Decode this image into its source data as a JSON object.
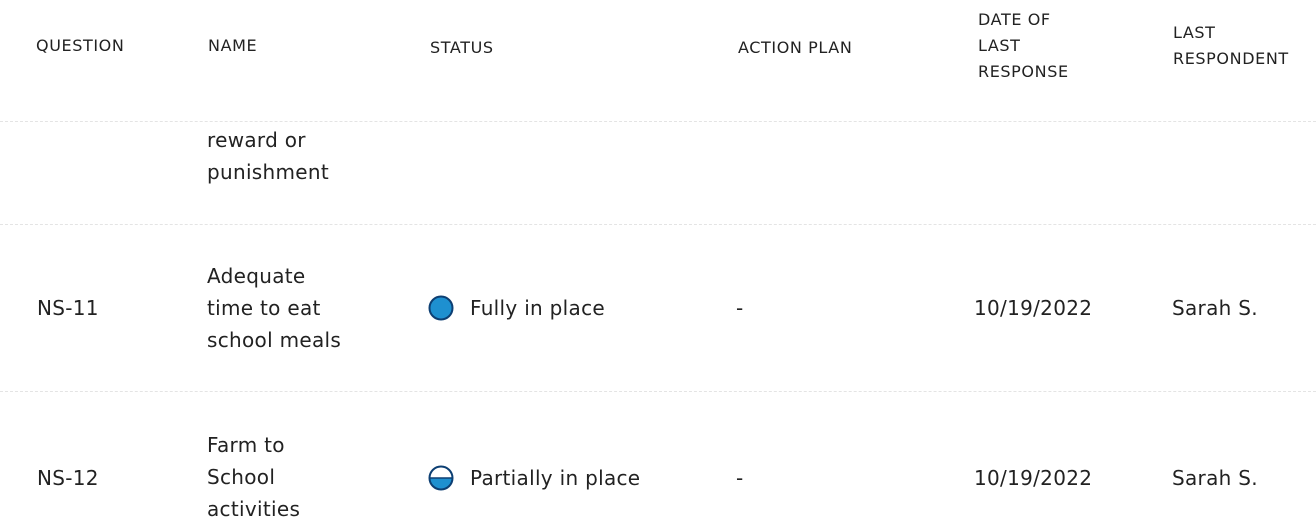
{
  "columns": {
    "question": "QUESTION",
    "name": "NAME",
    "status": "STATUS",
    "action_plan": "ACTION PLAN",
    "date_line1": "DATE OF",
    "date_line2": "LAST",
    "date_line3": "RESPONSE",
    "resp_line1": "LAST",
    "resp_line2": "RESPONDENT"
  },
  "rows": [
    {
      "question": "",
      "name_lines": [
        "reward or",
        "punishment"
      ],
      "status": "",
      "action_plan": "",
      "date": "",
      "respondent": ""
    },
    {
      "question": "NS-11",
      "name_lines": [
        "Adequate",
        "time to eat",
        "school meals"
      ],
      "status": "Fully in place",
      "status_level": 1.0,
      "action_plan": "-",
      "date": "10/19/2022",
      "respondent": "Sarah S."
    },
    {
      "question": "NS-12",
      "name_lines": [
        "Farm to",
        "School",
        "activities"
      ],
      "status": "Partially in place",
      "status_level": 0.5,
      "action_plan": "-",
      "date": "10/19/2022",
      "respondent": "Sarah S."
    }
  ],
  "colors": {
    "status_fill": "#1e90d0",
    "status_border": "#0d3f73",
    "divider": "#e4e4e4"
  },
  "icons": {
    "status_full": "full-circle-icon",
    "status_partial": "half-circle-icon"
  }
}
